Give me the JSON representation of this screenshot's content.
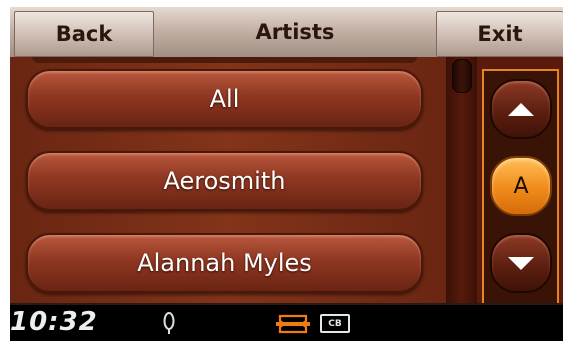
{
  "header": {
    "back_label": "Back",
    "title": "Artists",
    "exit_label": "Exit"
  },
  "artist_list": {
    "items": [
      {
        "label": "All"
      },
      {
        "label": "Aerosmith"
      },
      {
        "label": "Alannah Myles"
      }
    ]
  },
  "alphabet": {
    "current_letter": "A",
    "up_icon": "arrow-up-icon",
    "down_icon": "arrow-down-icon"
  },
  "status": {
    "time": "10:32",
    "cb_label": "CB",
    "mic_icon": "microphone-icon",
    "logo_icon": "brand-logo-icon"
  },
  "colors": {
    "accent": "#f28f1e",
    "list_background": "#6a2612",
    "status_bar": "#000000"
  }
}
